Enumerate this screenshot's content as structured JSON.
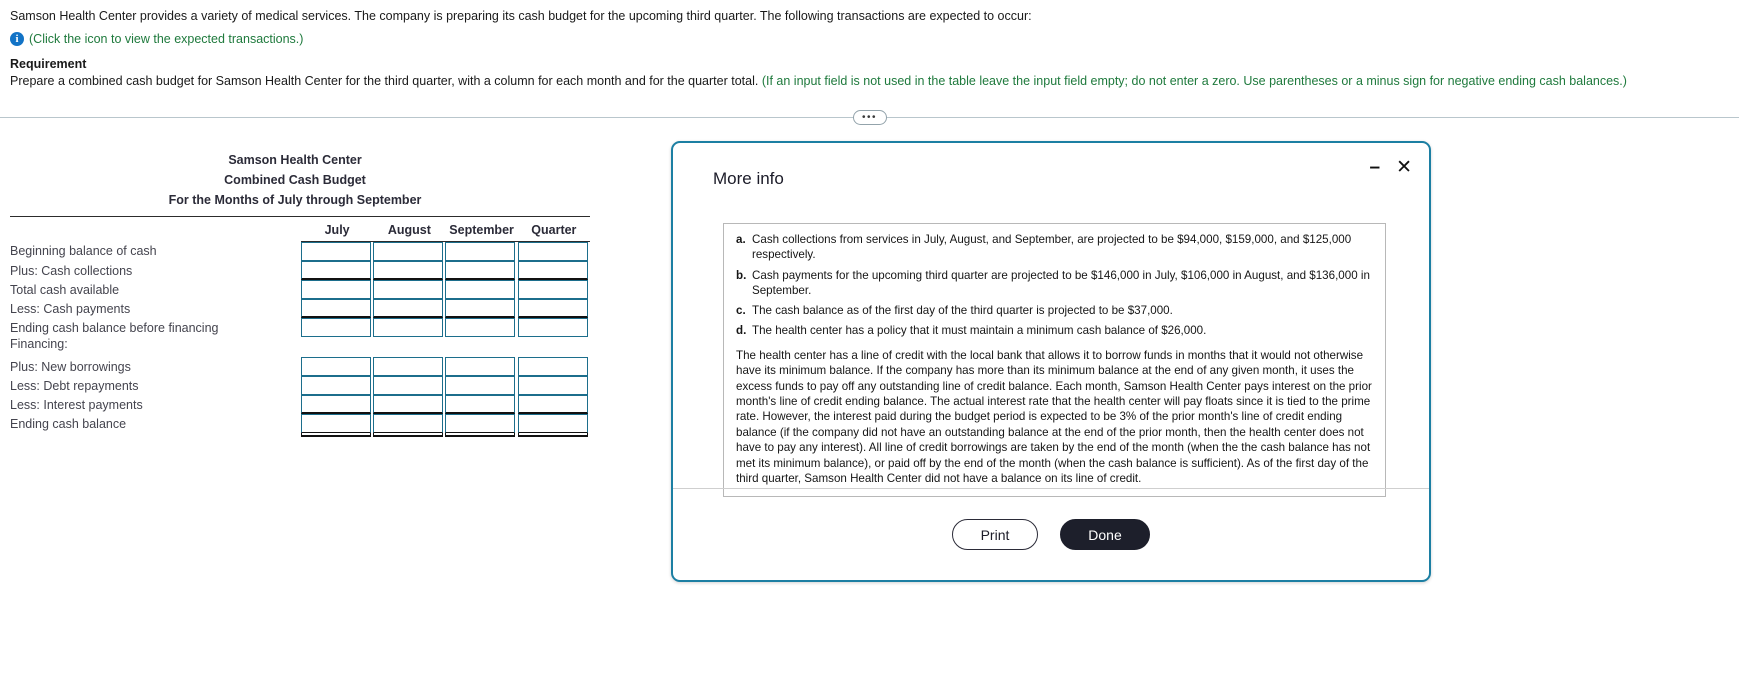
{
  "problem": {
    "intro": "Samson Health Center provides a variety of medical services. The company is preparing its cash budget for the upcoming third quarter. The following transactions are expected to occur:",
    "icon_name": "info-icon",
    "icon_link_text": "(Click the icon to view the expected transactions.)",
    "requirement_label": "Requirement",
    "requirement_black": "Prepare a combined cash budget for Samson Health Center for the third quarter, with a column for each month and for the quarter total.",
    "requirement_green": "(If an input field is not used in the table leave the input field empty; do not enter a zero. Use parentheses or a minus sign for negative ending cash balances.)",
    "divider_handle": "•••"
  },
  "worksheet": {
    "title_line1": "Samson Health Center",
    "title_line2": "Combined Cash Budget",
    "title_line3": "For the Months of July through September",
    "label_column_header": "",
    "columns": [
      "July",
      "August",
      "September",
      "Quarter"
    ],
    "rows": [
      {
        "label": "Beginning balance of cash",
        "indent": false,
        "inputs": true,
        "rule": "none"
      },
      {
        "label": "Plus: Cash collections",
        "indent": false,
        "inputs": true,
        "rule": "single"
      },
      {
        "label": "Total cash available",
        "indent": false,
        "inputs": true,
        "rule": "none"
      },
      {
        "label": "Less: Cash payments",
        "indent": false,
        "inputs": true,
        "rule": "single"
      },
      {
        "label": "Ending cash balance before financing",
        "indent": false,
        "inputs": true,
        "rule": "none"
      },
      {
        "label": "Financing:",
        "indent": false,
        "inputs": false,
        "rule": "none"
      },
      {
        "label": "Plus: New borrowings",
        "indent": true,
        "inputs": true,
        "rule": "none"
      },
      {
        "label": "Less: Debt repayments",
        "indent": true,
        "inputs": true,
        "rule": "none"
      },
      {
        "label": "Less: Interest payments",
        "indent": true,
        "inputs": true,
        "rule": "single"
      },
      {
        "label": "Ending cash balance",
        "indent": false,
        "inputs": true,
        "rule": "double"
      }
    ]
  },
  "dialog": {
    "title": "More info",
    "minimize_label": "–",
    "close_label": "✕",
    "items": [
      {
        "marker": "a.",
        "text": "Cash collections from services in July, August, and September, are projected to be $94,000, $159,000, and $125,000 respectively."
      },
      {
        "marker": "b.",
        "text": "Cash payments for the upcoming third quarter are projected to be $146,000 in July, $106,000 in August, and $136,000 in September."
      },
      {
        "marker": "c.",
        "text": "The cash balance as of the first day of the third quarter is projected to be $37,000."
      },
      {
        "marker": "d.",
        "text": "The health center has a policy that it must maintain a minimum cash balance of $26,000."
      }
    ],
    "paragraph": "The health center has a line of credit with the local bank that allows it to borrow funds in months that it would not otherwise have its minimum balance. If the company has more than its minimum balance at the end of any given month, it uses the excess funds to pay off any outstanding line of credit balance. Each month, Samson Health Center pays interest on the prior month's line of credit ending balance. The actual interest rate that the health center will pay floats since it is tied to the prime rate. However, the interest paid during the budget period is expected to be 3% of the prior month's line of credit ending balance (if the company did not have an outstanding balance at the end of the prior month, then the health center does not have to pay any interest). All line of credit borrowings are taken by the end of the month (when the the cash balance has not met its minimum balance), or paid off by the end of the month (when the cash balance is sufficient). As of the first day of the third quarter, Samson Health Center did not have a balance on its line of credit.",
    "print_label": "Print",
    "done_label": "Done"
  },
  "colors": {
    "info_icon_blue": "#1273c6",
    "green_text": "#1f7a3d",
    "input_border": "#1c6e8c",
    "dialog_border": "#1c7fa3",
    "done_button_bg": "#1d1f2b"
  }
}
